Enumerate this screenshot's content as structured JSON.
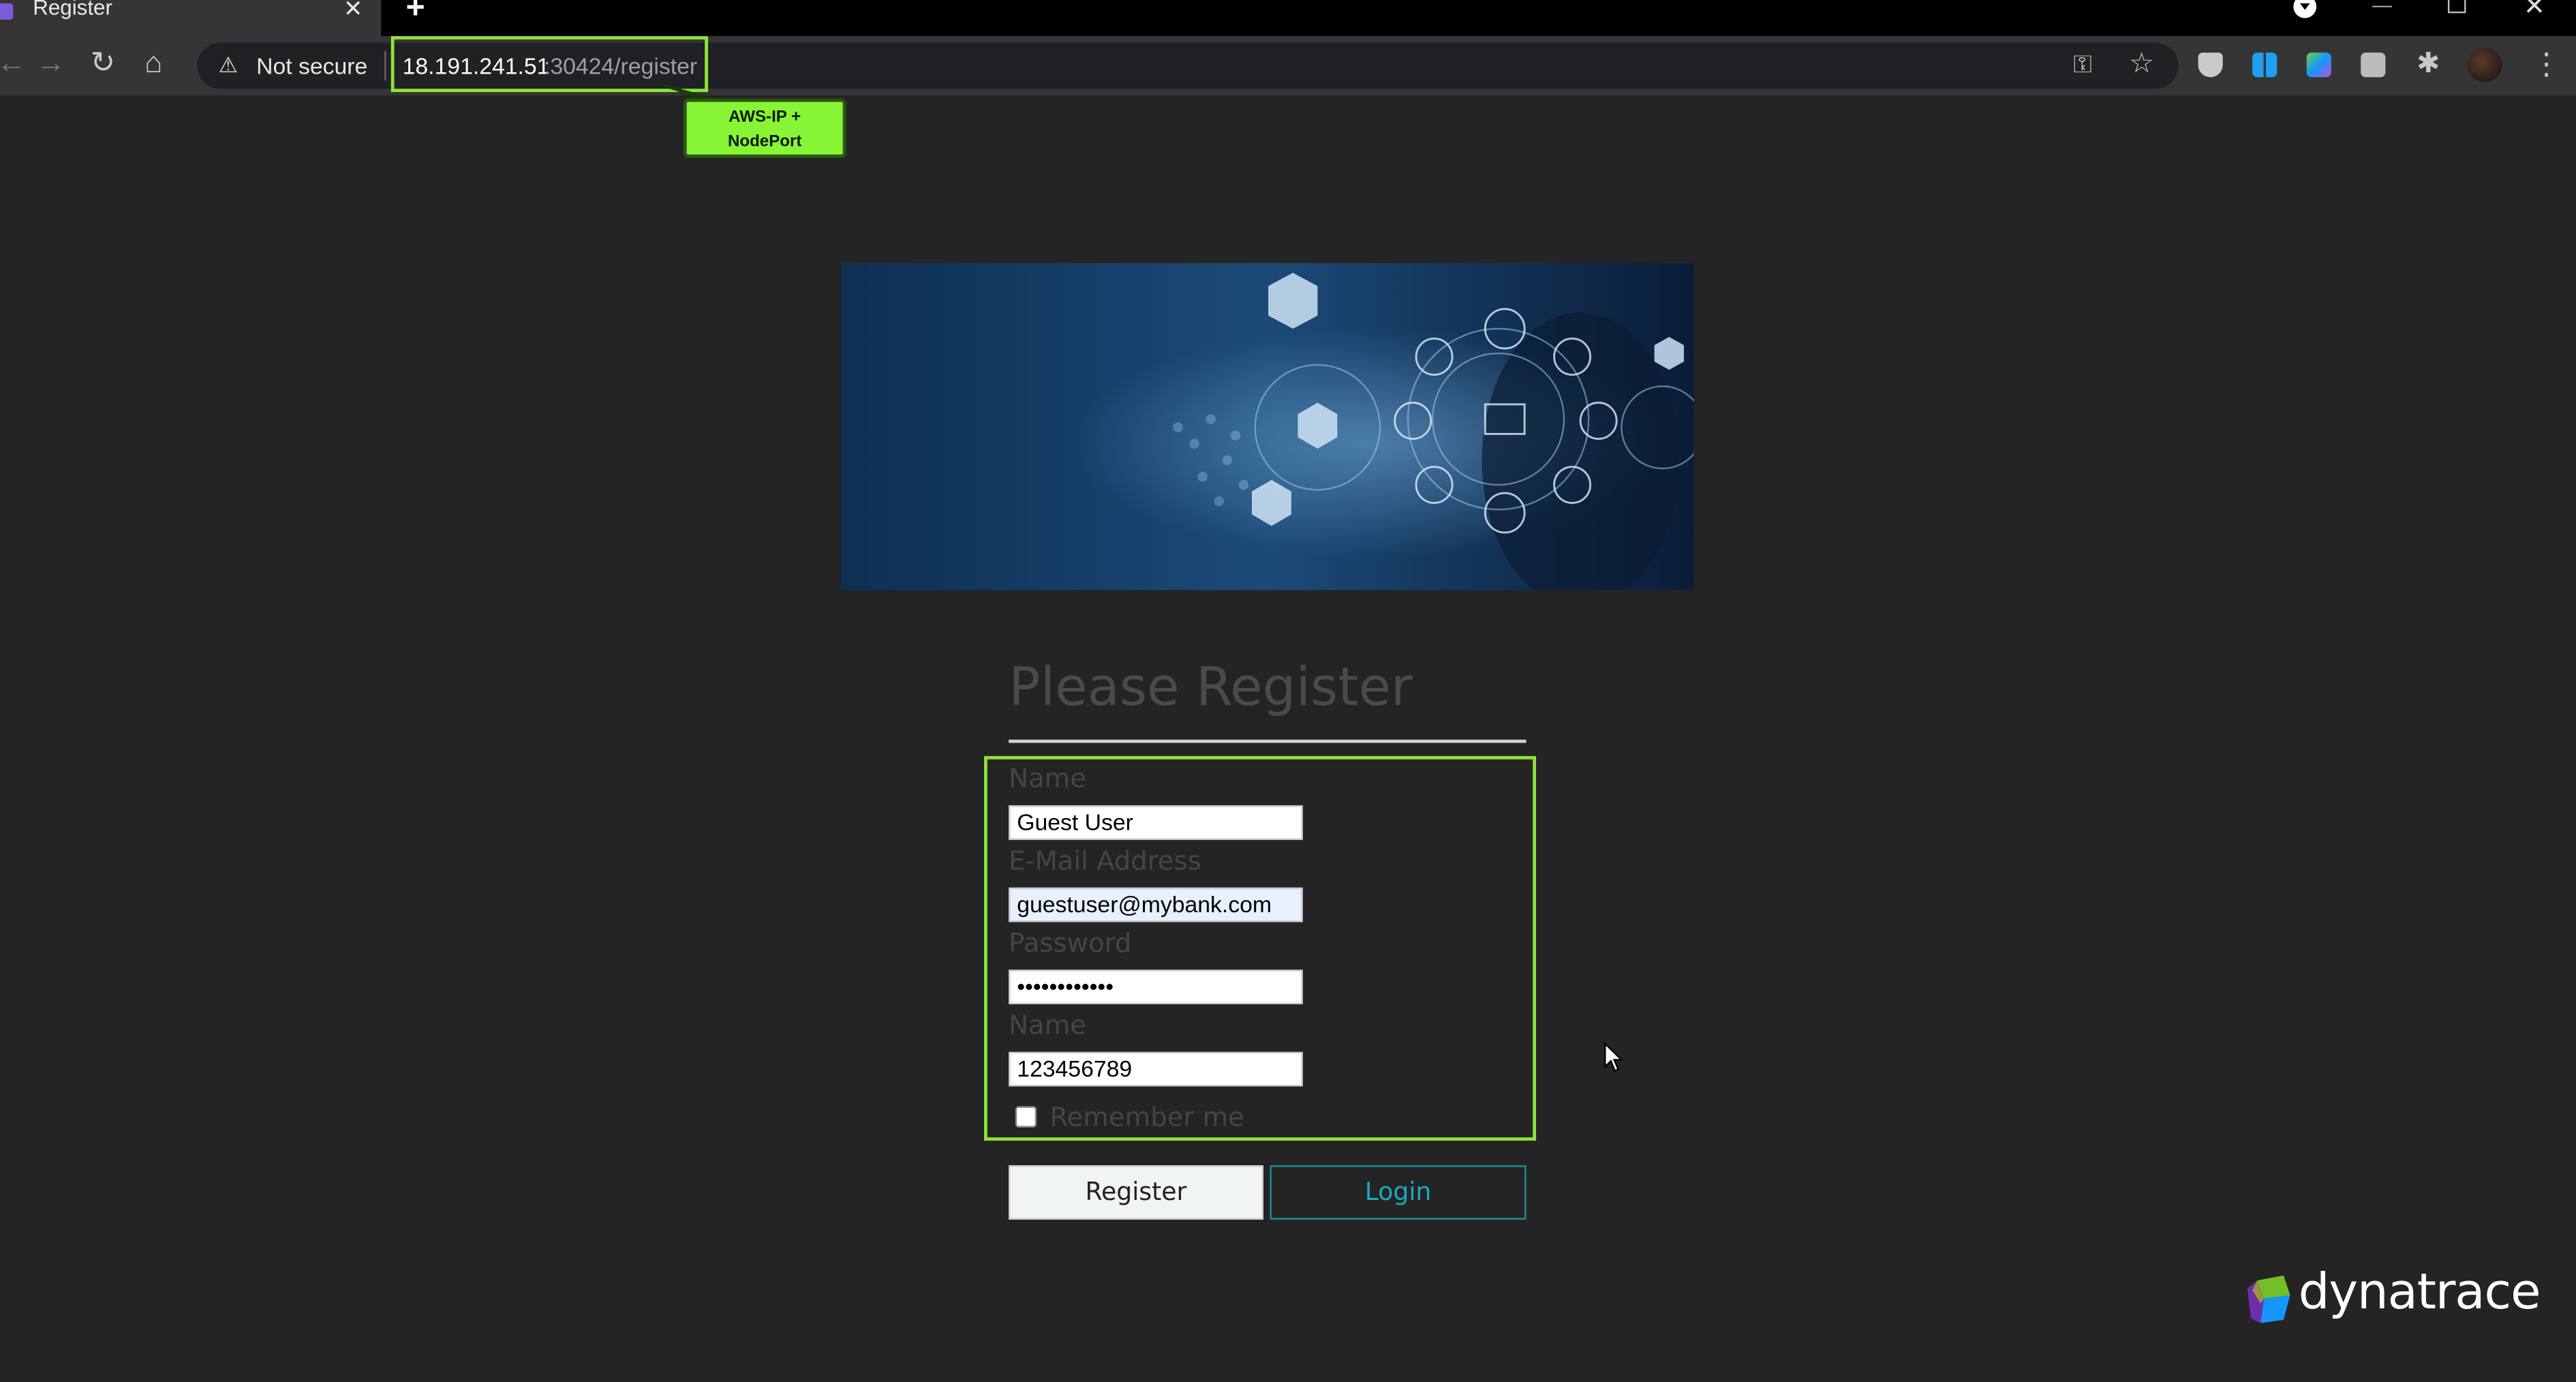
{
  "tab": {
    "title": "Register",
    "close": "✕",
    "new_tab": "+"
  },
  "toolbar": {
    "back": "←",
    "forward": "→",
    "reload": "↻",
    "home": "⌂",
    "security_icon": "⚠",
    "security_text": "Not secure",
    "url_host": "18.191.241.51",
    "url_path": ":30424/register",
    "key_icon": "⚿",
    "star_icon": "☆",
    "puzzle_icon": "✱",
    "menu_icon": "⋮"
  },
  "window": {
    "minimize": "—",
    "close": "✕"
  },
  "annotation": {
    "callout_text": "AWS-IP +\nNodePort",
    "highlight_color": "#8ee23a"
  },
  "form": {
    "title": "Please Register",
    "name_label": "Name",
    "name_value": "Guest User",
    "email_label": "E-Mail Address",
    "email_value": "guestuser@mybank.com",
    "password_label": "Password",
    "password_value": "••••••••••••",
    "phone_label": "Name",
    "phone_value": "123456789",
    "remember_label": "Remember me",
    "register_button": "Register",
    "login_button": "Login"
  },
  "logo": {
    "text": "dynatrace"
  },
  "colors": {
    "page_bg": "#242424",
    "accent_teal": "#1da9bd",
    "annotation_green": "#87f536"
  }
}
